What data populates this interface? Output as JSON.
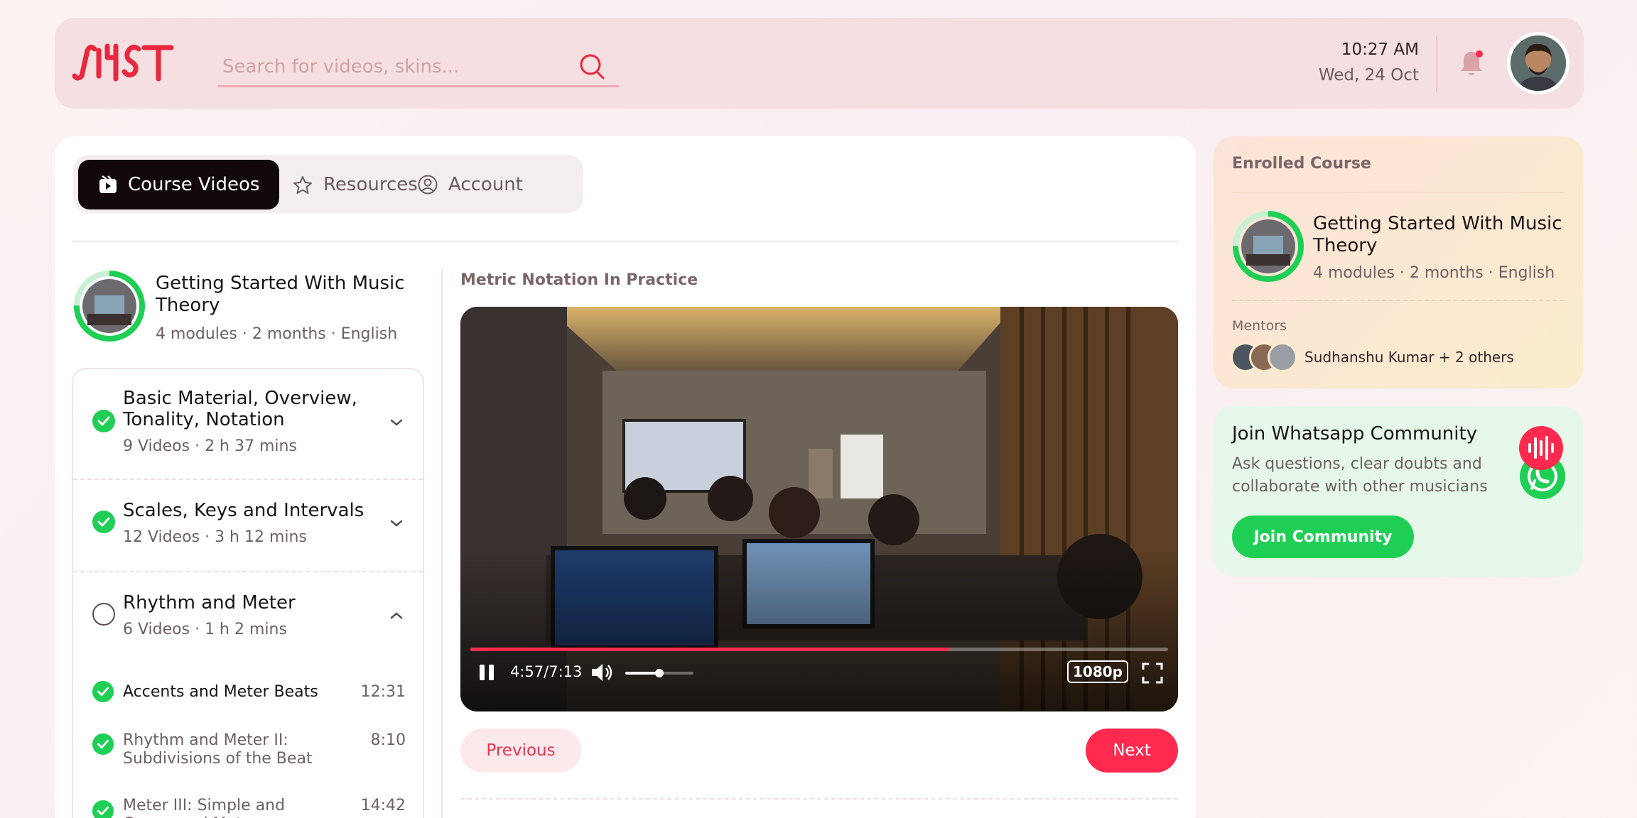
{
  "header": {
    "search_placeholder": "Search for videos, skins...",
    "time": "10:27 AM",
    "date": "Wed, 24 Oct"
  },
  "tabs": [
    {
      "label": "Course Videos",
      "icon": "video-icon",
      "active": true
    },
    {
      "label": "Resources",
      "icon": "star-icon",
      "active": false
    },
    {
      "label": "Account",
      "icon": "user-circle-icon",
      "active": false
    }
  ],
  "course": {
    "title": "Getting Started With Music Theory",
    "meta": "4 modules · 2 months · English",
    "progress": 0.75
  },
  "modules": [
    {
      "title": "Basic Material, Overview, Tonality, Notation",
      "meta": "9 Videos · 2 h 37 mins",
      "completed": true,
      "expanded": false
    },
    {
      "title": "Scales, Keys and Intervals",
      "meta": "12 Videos · 3 h 12 mins",
      "completed": true,
      "expanded": false
    },
    {
      "title": "Rhythm and Meter",
      "meta": "6 Videos · 1 h 2 mins",
      "completed": false,
      "expanded": true
    }
  ],
  "lessons": [
    {
      "title": "Accents and Meter Beats",
      "duration": "12:31",
      "completed": true,
      "current": true
    },
    {
      "title": "Rhythm and Meter II: Subdivisions of the Beat",
      "duration": "8:10",
      "completed": true,
      "current": false
    },
    {
      "title": "Meter III: Simple and Compound Meters",
      "duration": "14:42",
      "completed": true,
      "current": false
    }
  ],
  "video": {
    "title": "Metric Notation In Practice",
    "time": "4:57/7:13",
    "progress": 0.686,
    "volume": 0.5,
    "quality": "1080p"
  },
  "nav": {
    "previous": "Previous",
    "next": "Next"
  },
  "enrolled": {
    "label": "Enrolled Course",
    "title": "Getting Started With Music Theory",
    "meta": "4 modules · 2 months · English",
    "mentors_label": "Mentors",
    "mentors_text": "Sudhanshu Kumar + 2 others"
  },
  "community": {
    "title": "Join Whatsapp Community",
    "description": "Ask questions, clear doubts and collaborate with other musicians",
    "button": "Join Community"
  },
  "colors": {
    "accent": "#ff2a4e",
    "success": "#1fcf55",
    "dark": "#120809"
  }
}
